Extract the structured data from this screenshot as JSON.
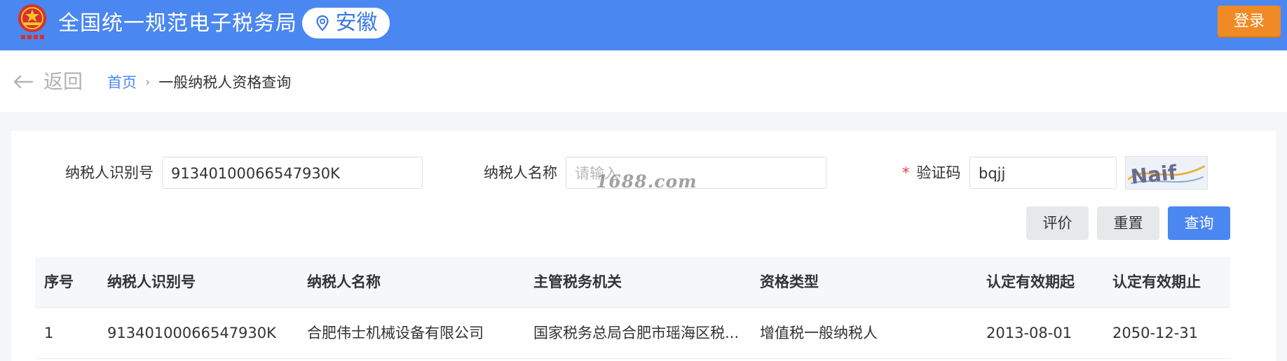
{
  "header": {
    "site_title": "全国统一规范电子税务局",
    "region": "安徽",
    "login_label": "登录",
    "emblem_icon": "tax-emblem-icon",
    "pin_icon": "location-pin-icon"
  },
  "nav": {
    "back_label": "返回",
    "breadcrumb_home": "首页",
    "breadcrumb_separator": "›",
    "breadcrumb_current": "一般纳税人资格查询"
  },
  "form": {
    "taxpayer_id_label": "纳税人识别号",
    "taxpayer_id_value": "91340100066547930K",
    "taxpayer_name_label": "纳税人名称",
    "taxpayer_name_placeholder": "请输入",
    "captcha_required_mark": "*",
    "captcha_label": "验证码",
    "captcha_value": "bqjj",
    "captcha_image_text": "Naif",
    "watermark": "1688.com",
    "evaluate_label": "评价",
    "reset_label": "重置",
    "query_label": "查询"
  },
  "table": {
    "columns": [
      "序号",
      "纳税人识别号",
      "纳税人名称",
      "主管税务机关",
      "资格类型",
      "认定有效期起",
      "认定有效期止"
    ],
    "rows": [
      [
        "1",
        "91340100066547930K",
        "合肥伟士机械设备有限公司",
        "国家税务总局合肥市瑶海区税...",
        "增值税一般纳税人",
        "2013-08-01",
        "2050-12-31"
      ]
    ]
  },
  "colors": {
    "header_blue": "#4a87f0",
    "login_orange": "#f08a24",
    "required_red": "#e23b3b"
  }
}
